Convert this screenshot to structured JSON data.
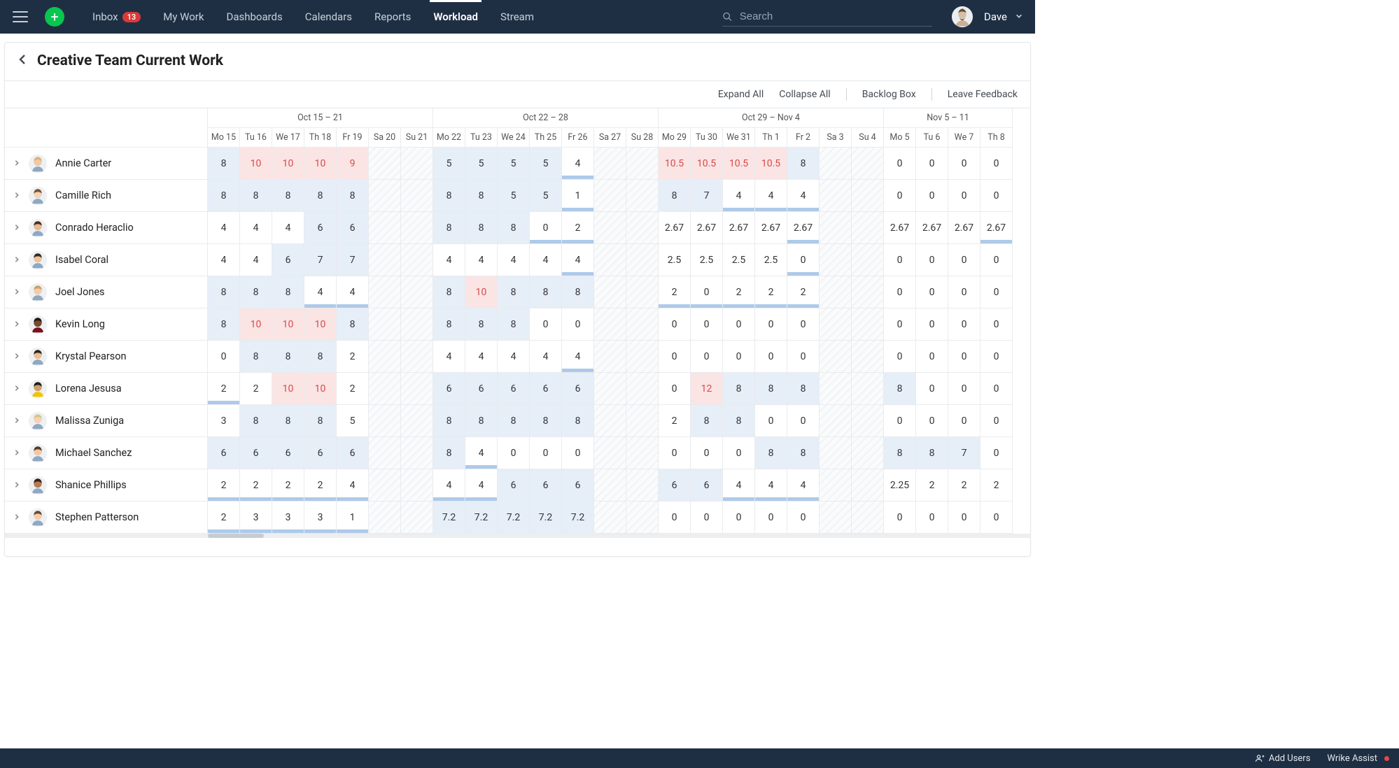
{
  "nav": {
    "items": [
      {
        "label": "Inbox",
        "badge": "13"
      },
      {
        "label": "My Work"
      },
      {
        "label": "Dashboards"
      },
      {
        "label": "Calendars"
      },
      {
        "label": "Reports"
      },
      {
        "label": "Workload",
        "active": true
      },
      {
        "label": "Stream"
      }
    ],
    "search_placeholder": "Search",
    "user_name": "Dave"
  },
  "page": {
    "title": "Creative Team Current Work",
    "actions": {
      "expand_all": "Expand All",
      "collapse_all": "Collapse All",
      "backlog_box": "Backlog Box",
      "leave_feedback": "Leave Feedback"
    }
  },
  "footer": {
    "add_users": "Add Users",
    "assist": "Wrike Assist"
  },
  "weeks": [
    {
      "label": "Oct 15 – 21",
      "days": [
        "Mo 15",
        "Tu 16",
        "We 17",
        "Th 18",
        "Fr 19",
        "Sa 20",
        "Su 21"
      ]
    },
    {
      "label": "Oct 22 – 28",
      "days": [
        "Mo 22",
        "Tu 23",
        "We 24",
        "Th 25",
        "Fr 26",
        "Sa 27",
        "Su 28"
      ]
    },
    {
      "label": "Oct 29 – Nov 4",
      "days": [
        "Mo 29",
        "Tu 30",
        "We 31",
        "Th 1",
        "Fr 2",
        "Sa 3",
        "Su 4"
      ]
    },
    {
      "label": "Nov 5 – 11",
      "days": [
        "Mo 5",
        "Tu 6",
        "We 7",
        "Th 8"
      ]
    }
  ],
  "people": [
    {
      "name": "Annie Carter",
      "hair": "#d9b380",
      "skin": "#f1c9a6",
      "cells": [
        {
          "v": "8",
          "s": "blue"
        },
        {
          "v": "10",
          "s": "red"
        },
        {
          "v": "10",
          "s": "red"
        },
        {
          "v": "10",
          "s": "red"
        },
        {
          "v": "9",
          "s": "red"
        },
        {
          "we": true
        },
        {
          "we": true
        },
        {
          "v": "5",
          "s": "blue"
        },
        {
          "v": "5",
          "s": "blue"
        },
        {
          "v": "5",
          "s": "blue"
        },
        {
          "v": "5",
          "s": "blue"
        },
        {
          "v": "4",
          "s": "under"
        },
        {
          "we": true
        },
        {
          "we": true
        },
        {
          "v": "10.5",
          "s": "red"
        },
        {
          "v": "10.5",
          "s": "red"
        },
        {
          "v": "10.5",
          "s": "red"
        },
        {
          "v": "10.5",
          "s": "red"
        },
        {
          "v": "8",
          "s": "blue"
        },
        {
          "we": true
        },
        {
          "we": true
        },
        {
          "v": "0"
        },
        {
          "v": "0"
        },
        {
          "v": "0"
        },
        {
          "v": "0"
        }
      ]
    },
    {
      "name": "Camille Rich",
      "hair": "#7a5230",
      "skin": "#f4d2b5",
      "cells": [
        {
          "v": "8",
          "s": "blue"
        },
        {
          "v": "8",
          "s": "blue"
        },
        {
          "v": "8",
          "s": "blue"
        },
        {
          "v": "8",
          "s": "blue"
        },
        {
          "v": "8",
          "s": "blue"
        },
        {
          "we": true
        },
        {
          "we": true
        },
        {
          "v": "8",
          "s": "blue"
        },
        {
          "v": "8",
          "s": "blue"
        },
        {
          "v": "5",
          "s": "blue"
        },
        {
          "v": "5",
          "s": "blue"
        },
        {
          "v": "1",
          "s": "under"
        },
        {
          "we": true
        },
        {
          "we": true
        },
        {
          "v": "8",
          "s": "blue"
        },
        {
          "v": "7",
          "s": "blue"
        },
        {
          "v": "4",
          "s": "under"
        },
        {
          "v": "4",
          "s": "under"
        },
        {
          "v": "4",
          "s": "under"
        },
        {
          "we": true
        },
        {
          "we": true
        },
        {
          "v": "0"
        },
        {
          "v": "0"
        },
        {
          "v": "0"
        },
        {
          "v": "0"
        }
      ]
    },
    {
      "name": "Conrado Heraclio",
      "hair": "#4a2f1a",
      "skin": "#e8b990",
      "cells": [
        {
          "v": "4"
        },
        {
          "v": "4"
        },
        {
          "v": "4"
        },
        {
          "v": "6",
          "s": "blue"
        },
        {
          "v": "6",
          "s": "blue"
        },
        {
          "we": true
        },
        {
          "we": true
        },
        {
          "v": "8",
          "s": "blue"
        },
        {
          "v": "8",
          "s": "blue"
        },
        {
          "v": "8",
          "s": "blue"
        },
        {
          "v": "0",
          "s": "under"
        },
        {
          "v": "2",
          "s": "under"
        },
        {
          "we": true
        },
        {
          "we": true
        },
        {
          "v": "2.67"
        },
        {
          "v": "2.67"
        },
        {
          "v": "2.67"
        },
        {
          "v": "2.67"
        },
        {
          "v": "2.67",
          "s": "under"
        },
        {
          "we": true
        },
        {
          "we": true
        },
        {
          "v": "2.67"
        },
        {
          "v": "2.67"
        },
        {
          "v": "2.67"
        },
        {
          "v": "2.67",
          "s": "under"
        }
      ]
    },
    {
      "name": "Isabel Coral",
      "hair": "#3a2718",
      "skin": "#eec29e",
      "cells": [
        {
          "v": "4"
        },
        {
          "v": "4"
        },
        {
          "v": "6",
          "s": "blue"
        },
        {
          "v": "7",
          "s": "blue"
        },
        {
          "v": "7",
          "s": "blue"
        },
        {
          "we": true
        },
        {
          "we": true
        },
        {
          "v": "4"
        },
        {
          "v": "4"
        },
        {
          "v": "4"
        },
        {
          "v": "4"
        },
        {
          "v": "4",
          "s": "under"
        },
        {
          "we": true
        },
        {
          "we": true
        },
        {
          "v": "2.5"
        },
        {
          "v": "2.5"
        },
        {
          "v": "2.5"
        },
        {
          "v": "2.5"
        },
        {
          "v": "0",
          "s": "under"
        },
        {
          "we": true
        },
        {
          "we": true
        },
        {
          "v": "0"
        },
        {
          "v": "0"
        },
        {
          "v": "0"
        },
        {
          "v": "0"
        }
      ]
    },
    {
      "name": "Joel Jones",
      "hair": "#c8a268",
      "skin": "#f3cda9",
      "cells": [
        {
          "v": "8",
          "s": "blue"
        },
        {
          "v": "8",
          "s": "blue"
        },
        {
          "v": "8",
          "s": "blue"
        },
        {
          "v": "4",
          "s": "under"
        },
        {
          "v": "4",
          "s": "under"
        },
        {
          "we": true
        },
        {
          "we": true
        },
        {
          "v": "8",
          "s": "blue"
        },
        {
          "v": "10",
          "s": "red"
        },
        {
          "v": "8",
          "s": "blue"
        },
        {
          "v": "8",
          "s": "blue"
        },
        {
          "v": "8",
          "s": "blue"
        },
        {
          "we": true
        },
        {
          "we": true
        },
        {
          "v": "2",
          "s": "under"
        },
        {
          "v": "0",
          "s": "under"
        },
        {
          "v": "2",
          "s": "under"
        },
        {
          "v": "2",
          "s": "under"
        },
        {
          "v": "2",
          "s": "under"
        },
        {
          "we": true
        },
        {
          "we": true
        },
        {
          "v": "0"
        },
        {
          "v": "0"
        },
        {
          "v": "0"
        },
        {
          "v": "0"
        }
      ]
    },
    {
      "name": "Kevin Long",
      "hair": "#1e1a16",
      "skin": "#7a4a2f",
      "shirt": "#7a1220",
      "cells": [
        {
          "v": "8",
          "s": "blue"
        },
        {
          "v": "10",
          "s": "red"
        },
        {
          "v": "10",
          "s": "red"
        },
        {
          "v": "10",
          "s": "red"
        },
        {
          "v": "8",
          "s": "blue"
        },
        {
          "we": true
        },
        {
          "we": true
        },
        {
          "v": "8",
          "s": "blue"
        },
        {
          "v": "8",
          "s": "blue"
        },
        {
          "v": "8",
          "s": "blue"
        },
        {
          "v": "0"
        },
        {
          "v": "0"
        },
        {
          "we": true
        },
        {
          "we": true
        },
        {
          "v": "0"
        },
        {
          "v": "0"
        },
        {
          "v": "0"
        },
        {
          "v": "0"
        },
        {
          "v": "0"
        },
        {
          "we": true
        },
        {
          "we": true
        },
        {
          "v": "0"
        },
        {
          "v": "0"
        },
        {
          "v": "0"
        },
        {
          "v": "0"
        }
      ]
    },
    {
      "name": "Krystal Pearson",
      "hair": "#2f241a",
      "skin": "#e9bd96",
      "cells": [
        {
          "v": "0"
        },
        {
          "v": "8",
          "s": "blue"
        },
        {
          "v": "8",
          "s": "blue"
        },
        {
          "v": "8",
          "s": "blue"
        },
        {
          "v": "2"
        },
        {
          "we": true
        },
        {
          "we": true
        },
        {
          "v": "4"
        },
        {
          "v": "4"
        },
        {
          "v": "4"
        },
        {
          "v": "4"
        },
        {
          "v": "4",
          "s": "under"
        },
        {
          "we": true
        },
        {
          "we": true
        },
        {
          "v": "0"
        },
        {
          "v": "0"
        },
        {
          "v": "0"
        },
        {
          "v": "0"
        },
        {
          "v": "0"
        },
        {
          "we": true
        },
        {
          "we": true
        },
        {
          "v": "0"
        },
        {
          "v": "0"
        },
        {
          "v": "0"
        },
        {
          "v": "0"
        }
      ]
    },
    {
      "name": "Lorena Jesusa",
      "hair": "#1f1a14",
      "skin": "#caa06a",
      "shirt": "#f2c300",
      "cells": [
        {
          "v": "2",
          "s": "under"
        },
        {
          "v": "2"
        },
        {
          "v": "10",
          "s": "red"
        },
        {
          "v": "10",
          "s": "red"
        },
        {
          "v": "2"
        },
        {
          "we": true
        },
        {
          "we": true
        },
        {
          "v": "6",
          "s": "blue"
        },
        {
          "v": "6",
          "s": "blue"
        },
        {
          "v": "6",
          "s": "blue"
        },
        {
          "v": "6",
          "s": "blue"
        },
        {
          "v": "6",
          "s": "blue"
        },
        {
          "we": true
        },
        {
          "we": true
        },
        {
          "v": "0"
        },
        {
          "v": "12",
          "s": "red"
        },
        {
          "v": "8",
          "s": "blue"
        },
        {
          "v": "8",
          "s": "blue"
        },
        {
          "v": "8",
          "s": "blue"
        },
        {
          "we": true
        },
        {
          "we": true
        },
        {
          "v": "8",
          "s": "blue"
        },
        {
          "v": "0"
        },
        {
          "v": "0"
        },
        {
          "v": "0"
        }
      ]
    },
    {
      "name": "Malissa Zuniga",
      "hair": "#d8c48a",
      "skin": "#f4d4b6",
      "cells": [
        {
          "v": "3"
        },
        {
          "v": "8",
          "s": "blue"
        },
        {
          "v": "8",
          "s": "blue"
        },
        {
          "v": "8",
          "s": "blue"
        },
        {
          "v": "5"
        },
        {
          "we": true
        },
        {
          "we": true
        },
        {
          "v": "8",
          "s": "blue"
        },
        {
          "v": "8",
          "s": "blue"
        },
        {
          "v": "8",
          "s": "blue"
        },
        {
          "v": "8",
          "s": "blue"
        },
        {
          "v": "8",
          "s": "blue"
        },
        {
          "we": true
        },
        {
          "we": true
        },
        {
          "v": "2"
        },
        {
          "v": "8",
          "s": "blue"
        },
        {
          "v": "8",
          "s": "blue"
        },
        {
          "v": "0"
        },
        {
          "v": "0"
        },
        {
          "we": true
        },
        {
          "we": true
        },
        {
          "v": "0"
        },
        {
          "v": "0"
        },
        {
          "v": "0"
        },
        {
          "v": "0"
        }
      ]
    },
    {
      "name": "Michael Sanchez",
      "hair": "#5a3a24",
      "skin": "#f0c9a4",
      "cells": [
        {
          "v": "6",
          "s": "blue"
        },
        {
          "v": "6",
          "s": "blue"
        },
        {
          "v": "6",
          "s": "blue"
        },
        {
          "v": "6",
          "s": "blue"
        },
        {
          "v": "6",
          "s": "blue"
        },
        {
          "we": true
        },
        {
          "we": true
        },
        {
          "v": "8",
          "s": "blue"
        },
        {
          "v": "4",
          "s": "under"
        },
        {
          "v": "0"
        },
        {
          "v": "0"
        },
        {
          "v": "0"
        },
        {
          "we": true
        },
        {
          "we": true
        },
        {
          "v": "0"
        },
        {
          "v": "0"
        },
        {
          "v": "0"
        },
        {
          "v": "8",
          "s": "blue"
        },
        {
          "v": "8",
          "s": "blue"
        },
        {
          "we": true
        },
        {
          "we": true
        },
        {
          "v": "8",
          "s": "blue"
        },
        {
          "v": "8",
          "s": "blue"
        },
        {
          "v": "7",
          "s": "blue"
        },
        {
          "v": "0"
        }
      ]
    },
    {
      "name": "Shanice Phillips",
      "hair": "#3a1f14",
      "skin": "#b77a50",
      "cells": [
        {
          "v": "2",
          "s": "under"
        },
        {
          "v": "2",
          "s": "under"
        },
        {
          "v": "2",
          "s": "under"
        },
        {
          "v": "2",
          "s": "under"
        },
        {
          "v": "4",
          "s": "under"
        },
        {
          "we": true
        },
        {
          "we": true
        },
        {
          "v": "4",
          "s": "under"
        },
        {
          "v": "4",
          "s": "under"
        },
        {
          "v": "6",
          "s": "blue"
        },
        {
          "v": "6",
          "s": "blue"
        },
        {
          "v": "6",
          "s": "blue"
        },
        {
          "we": true
        },
        {
          "we": true
        },
        {
          "v": "6",
          "s": "blue"
        },
        {
          "v": "6",
          "s": "blue"
        },
        {
          "v": "4",
          "s": "under"
        },
        {
          "v": "4",
          "s": "under"
        },
        {
          "v": "4",
          "s": "under"
        },
        {
          "we": true
        },
        {
          "we": true
        },
        {
          "v": "2.25"
        },
        {
          "v": "2"
        },
        {
          "v": "2"
        },
        {
          "v": "2"
        }
      ]
    },
    {
      "name": "Stephen Patterson",
      "hair": "#6a4a30",
      "skin": "#f2cead",
      "cells": [
        {
          "v": "2",
          "s": "under"
        },
        {
          "v": "3",
          "s": "under"
        },
        {
          "v": "3",
          "s": "under"
        },
        {
          "v": "3",
          "s": "under"
        },
        {
          "v": "1",
          "s": "under"
        },
        {
          "we": true
        },
        {
          "we": true
        },
        {
          "v": "7.2",
          "s": "blue"
        },
        {
          "v": "7.2",
          "s": "blue"
        },
        {
          "v": "7.2",
          "s": "blue"
        },
        {
          "v": "7.2",
          "s": "blue"
        },
        {
          "v": "7.2",
          "s": "blue"
        },
        {
          "we": true
        },
        {
          "we": true
        },
        {
          "v": "0"
        },
        {
          "v": "0"
        },
        {
          "v": "0"
        },
        {
          "v": "0"
        },
        {
          "v": "0"
        },
        {
          "we": true
        },
        {
          "we": true
        },
        {
          "v": "0"
        },
        {
          "v": "0"
        },
        {
          "v": "0"
        },
        {
          "v": "0"
        }
      ]
    }
  ]
}
